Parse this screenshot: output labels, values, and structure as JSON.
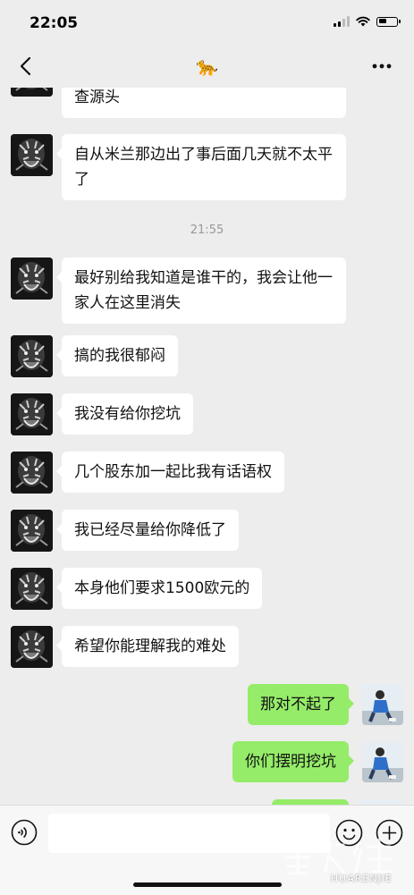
{
  "status_bar": {
    "time": "22:05"
  },
  "header": {
    "title_icon": "leopard-emoji",
    "title_emoji": "🐆"
  },
  "messages": [
    {
      "type": "in",
      "text": "查源头"
    },
    {
      "type": "in",
      "text": "自从米兰那边出了事后面几天就不太平了"
    },
    {
      "type": "time",
      "text": "21:55"
    },
    {
      "type": "in",
      "text": "最好别给我知道是谁干的，我会让他一家人在这里消失"
    },
    {
      "type": "in",
      "text": "搞的我很郁闷"
    },
    {
      "type": "in",
      "text": "我没有给你挖坑"
    },
    {
      "type": "in",
      "text": "几个股东加一起比我有话语权"
    },
    {
      "type": "in",
      "text": "我已经尽量给你降低了"
    },
    {
      "type": "in",
      "text": "本身他们要求1500欧元的"
    },
    {
      "type": "in",
      "text": "希望你能理解我的难处"
    },
    {
      "type": "out",
      "text": "那对不起了"
    },
    {
      "type": "out",
      "text": "你们摆明挖坑"
    },
    {
      "type": "out",
      "text": ""
    }
  ],
  "input": {
    "placeholder": ""
  },
  "watermark": {
    "brand": "华人街",
    "site": "HUARENJIE"
  },
  "colors": {
    "background": "#ededed",
    "incoming_bubble": "#ffffff",
    "outgoing_bubble": "#95ec69",
    "timestamp": "#999999"
  }
}
